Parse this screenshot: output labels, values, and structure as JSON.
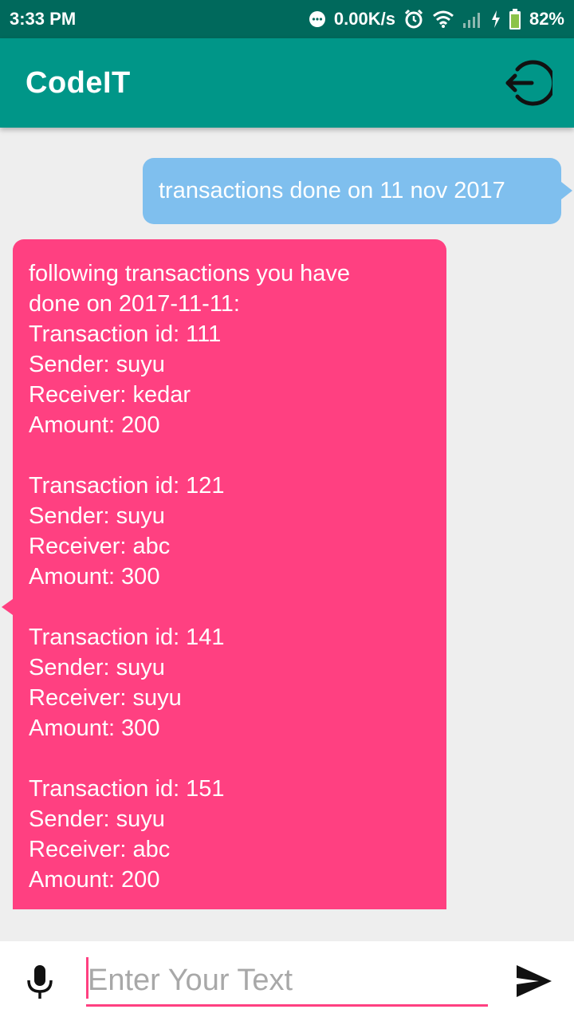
{
  "status_bar": {
    "time": "3:33 PM",
    "network_speed": "0.00K/s",
    "battery": "82%",
    "icons": [
      "chat-notification-icon",
      "alarm-icon",
      "wifi-icon",
      "signal-icon",
      "charging-icon",
      "battery-icon"
    ]
  },
  "app_bar": {
    "title": "CodeIT",
    "action_icon": "logout-icon",
    "color": "#009688"
  },
  "messages": [
    {
      "sender": "user",
      "color": "#7fbfee",
      "text": "transactions done on 11 nov 2017"
    },
    {
      "sender": "bot",
      "color": "#ff4081",
      "lines": [
        "following transactions you have",
        "done on 2017-11-11:",
        "Transaction id: 111",
        "Sender: suyu",
        "Receiver: kedar",
        "Amount: 200",
        "",
        "Transaction id: 121",
        "Sender: suyu",
        "Receiver: abc",
        "Amount: 300",
        "",
        "Transaction id: 141",
        "Sender: suyu",
        "Receiver: suyu",
        "Amount: 300",
        "",
        "Transaction id: 151",
        "Sender: suyu",
        "Receiver: abc",
        "Amount: 200"
      ]
    }
  ],
  "input_bar": {
    "placeholder": "Enter Your Text",
    "value": "",
    "mic_icon": "microphone-icon",
    "send_icon": "send-icon",
    "accent": "#ff4081"
  }
}
